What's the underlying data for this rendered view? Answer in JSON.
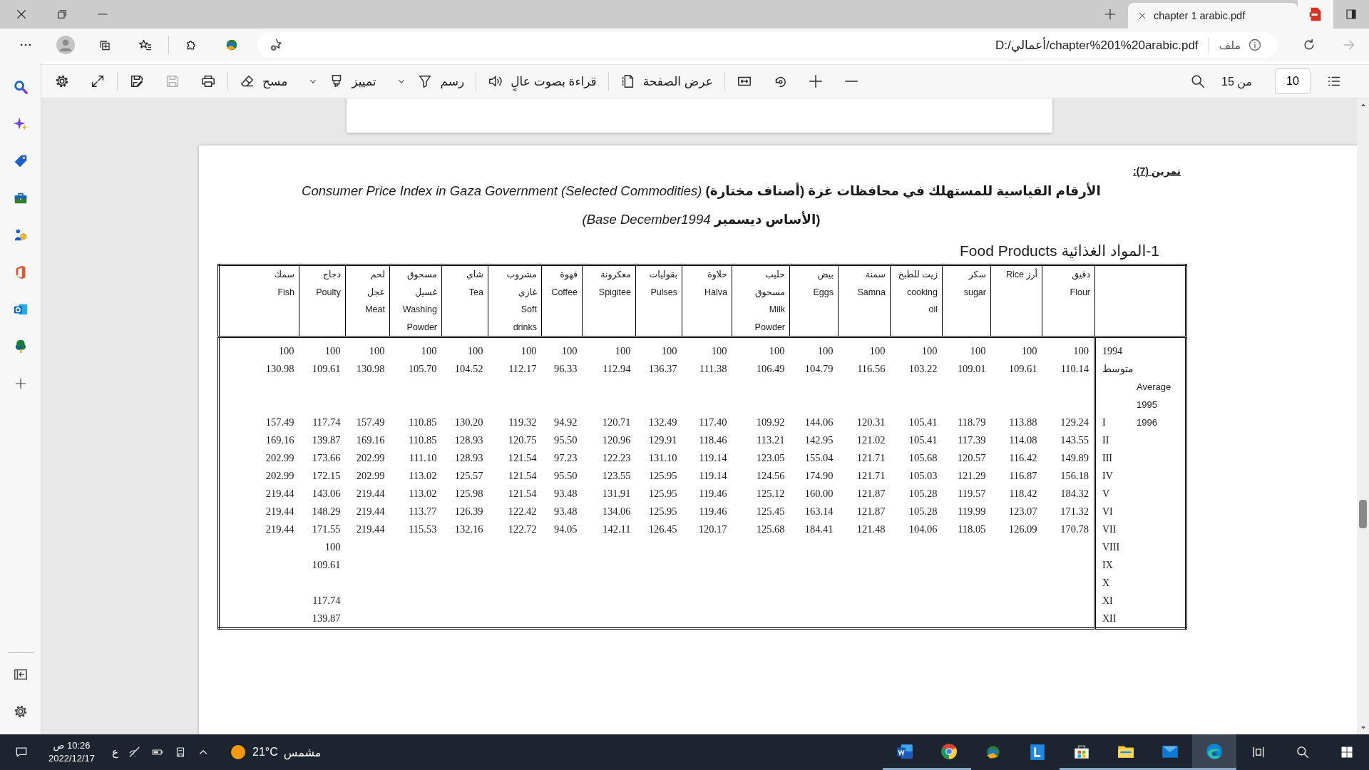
{
  "window": {
    "tab_title": "chapter 1 arabic.pdf"
  },
  "address_bar": {
    "url": "D:/أعمالي/chapter%201%20arabic.pdf",
    "scheme_label": "ملف",
    "forward_disabled": true
  },
  "pdf_toolbar": {
    "page_number": "10",
    "page_count": "من 15",
    "tool_groups": [
      {
        "tools": [
          {
            "kind": "zoom_out",
            "disabled": false
          },
          {
            "kind": "zoom_in",
            "disabled": false
          },
          {
            "kind": "rotate",
            "disabled": false
          },
          {
            "kind": "fit_width",
            "disabled": false
          }
        ]
      },
      {
        "tools": [
          {
            "kind": "page_view",
            "label": "عرض الصفحة",
            "disabled": false
          }
        ]
      },
      {
        "tools": [
          {
            "kind": "read_aloud",
            "label": "قراءة بصوت عالٍ",
            "disabled": false
          }
        ]
      },
      {
        "tools": [
          {
            "kind": "draw",
            "label": "رسم",
            "disabled": false
          },
          {
            "kind": "highlight",
            "label": "تمييز",
            "disabled": false
          },
          {
            "kind": "erase",
            "label": "مسح",
            "disabled": false
          }
        ]
      },
      {
        "tools": [
          {
            "kind": "print",
            "disabled": false
          },
          {
            "kind": "save",
            "disabled": true
          },
          {
            "kind": "save_as",
            "disabled": false
          }
        ]
      },
      {
        "tools": [
          {
            "kind": "fullscreen",
            "disabled": false
          },
          {
            "kind": "settings",
            "disabled": false
          }
        ]
      }
    ]
  },
  "document": {
    "exercise_label": "تمرين (7):",
    "title_line_1": "**الأرقام القياسية للمستهلك  في محافظات غزة (أصناف مختارة)** *Consumer Price Index in Gaza Government (Selected Commodities)*",
    "title_line_2": "**(الأساس ديسمبر** *Base December1994)*",
    "section_heading": "1-المواد الغذائية Food Products",
    "table": {
      "columns": [
        {
          "lines": [
            "سمك",
            "Fish"
          ]
        },
        {
          "lines": [
            "دجاج",
            "Poulty"
          ]
        },
        {
          "lines": [
            "لحم",
            "عجل",
            "Meat"
          ]
        },
        {
          "lines": [
            "مسحوق",
            "غسيل",
            "Washing",
            "Powder"
          ]
        },
        {
          "lines": [
            "شاي",
            "Tea"
          ]
        },
        {
          "lines": [
            "مشروب",
            "غازي",
            "Soft",
            "drinks"
          ]
        },
        {
          "lines": [
            "قهوة",
            "Coffee"
          ]
        },
        {
          "lines": [
            "معكرونة",
            "Spigitee"
          ]
        },
        {
          "lines": [
            "بقوليات",
            "Pulses"
          ]
        },
        {
          "lines": [
            "حلاوة",
            "Halva"
          ]
        },
        {
          "lines": [
            "حليب",
            "مسحوق",
            "Milk",
            "Powder"
          ]
        },
        {
          "lines": [
            "بيض",
            "Eggs"
          ]
        },
        {
          "lines": [
            "سمنة",
            "Samna"
          ]
        },
        {
          "lines": [
            "زيت للطبخ",
            "cooking",
            "oil"
          ]
        },
        {
          "lines": [
            "سكر",
            "sugar"
          ]
        },
        {
          "lines": [
            "أرز Rice"
          ]
        },
        {
          "lines": [
            "دقيق",
            "Flour"
          ]
        }
      ],
      "rows": [
        {
          "label": "1994",
          "values": [
            "100",
            "100",
            "100",
            "100",
            "100",
            "100",
            "100",
            "100",
            "100",
            "100",
            "100",
            "100",
            "100",
            "100",
            "100",
            "100",
            "100"
          ]
        },
        {
          "label": "متوسط",
          "values": [
            "130.98",
            "109.61",
            "130.98",
            "105.70",
            "104.52",
            "112.17",
            "96.33",
            "112.94",
            "136.37",
            "111.38",
            "106.49",
            "104.79",
            "116.56",
            "103.22",
            "109.01",
            "109.61",
            "110.14"
          ]
        },
        {
          "label_2": "Average"
        },
        {
          "label_2": "1995"
        },
        {
          "label": "I",
          "label_2": "1996",
          "values": [
            "157.49",
            "117.74",
            "157.49",
            "110.85",
            "130.20",
            "119.32",
            "94.92",
            "120.71",
            "132.49",
            "117.40",
            "109.92",
            "144.06",
            "120.31",
            "105.41",
            "118.79",
            "113.88",
            "129.24"
          ]
        },
        {
          "label": "II",
          "values": [
            "169.16",
            "139.87",
            "169.16",
            "110.85",
            "128.93",
            "120.75",
            "95.50",
            "120.96",
            "129.91",
            "118.46",
            "113.21",
            "142.95",
            "121.02",
            "105.41",
            "117.39",
            "114.08",
            "143.55"
          ]
        },
        {
          "label": "III",
          "values": [
            "202.99",
            "173.66",
            "202.99",
            "111.10",
            "128.93",
            "121.54",
            "97.23",
            "122.23",
            "131.10",
            "119.14",
            "123.05",
            "155.04",
            "121.71",
            "105.68",
            "120.57",
            "116.42",
            "149.89"
          ]
        },
        {
          "label": "IV",
          "values": [
            "202.99",
            "172.15",
            "202.99",
            "113.02",
            "125.57",
            "121.54",
            "95.50",
            "123.55",
            "125.95",
            "119.14",
            "124.56",
            "174.90",
            "121.71",
            "105.03",
            "121.29",
            "116.87",
            "156.18"
          ]
        },
        {
          "label": "V",
          "values": [
            "219.44",
            "143.06",
            "219.44",
            "113.02",
            "125.98",
            "121.54",
            "93.48",
            "131.91",
            "125.95",
            "119.46",
            "125.12",
            "160.00",
            "121.87",
            "105.28",
            "119.57",
            "118.42",
            "184.32"
          ]
        },
        {
          "label": "VI",
          "values": [
            "219.44",
            "148.29",
            "219.44",
            "113.77",
            "126.39",
            "122.42",
            "93.48",
            "134.06",
            "125.95",
            "119.46",
            "125.45",
            "163.14",
            "121.87",
            "105.28",
            "119.99",
            "123.07",
            "171.32"
          ]
        },
        {
          "label": "VII",
          "values": [
            "219.44",
            "171.55",
            "219.44",
            "115.53",
            "132.16",
            "122.72",
            "94.05",
            "142.11",
            "126.45",
            "120.17",
            "125.68",
            "184.41",
            "121.48",
            "104.06",
            "118.05",
            "126.09",
            "170.78"
          ]
        },
        {
          "label": "VIII",
          "cells": [
            {
              "kind": "blank"
            },
            {
              "kind": "value",
              "text": "100"
            }
          ]
        },
        {
          "label": "IX",
          "cells": [
            {
              "kind": "blank"
            },
            {
              "kind": "value",
              "text": "109.61"
            }
          ]
        },
        {
          "label": "X"
        },
        {
          "label": "XI",
          "cells": [
            {
              "kind": "blank"
            },
            {
              "kind": "value",
              "text": "117.74"
            }
          ]
        },
        {
          "label": "XII",
          "cells": [
            {
              "kind": "blank"
            },
            {
              "kind": "value",
              "text": "139.87"
            }
          ]
        }
      ]
    }
  },
  "taskbar": {
    "time": "10:26 ص",
    "date": "2022/12/17",
    "input_language": "ع",
    "temperature": "21°C",
    "weather": "مشمس"
  }
}
